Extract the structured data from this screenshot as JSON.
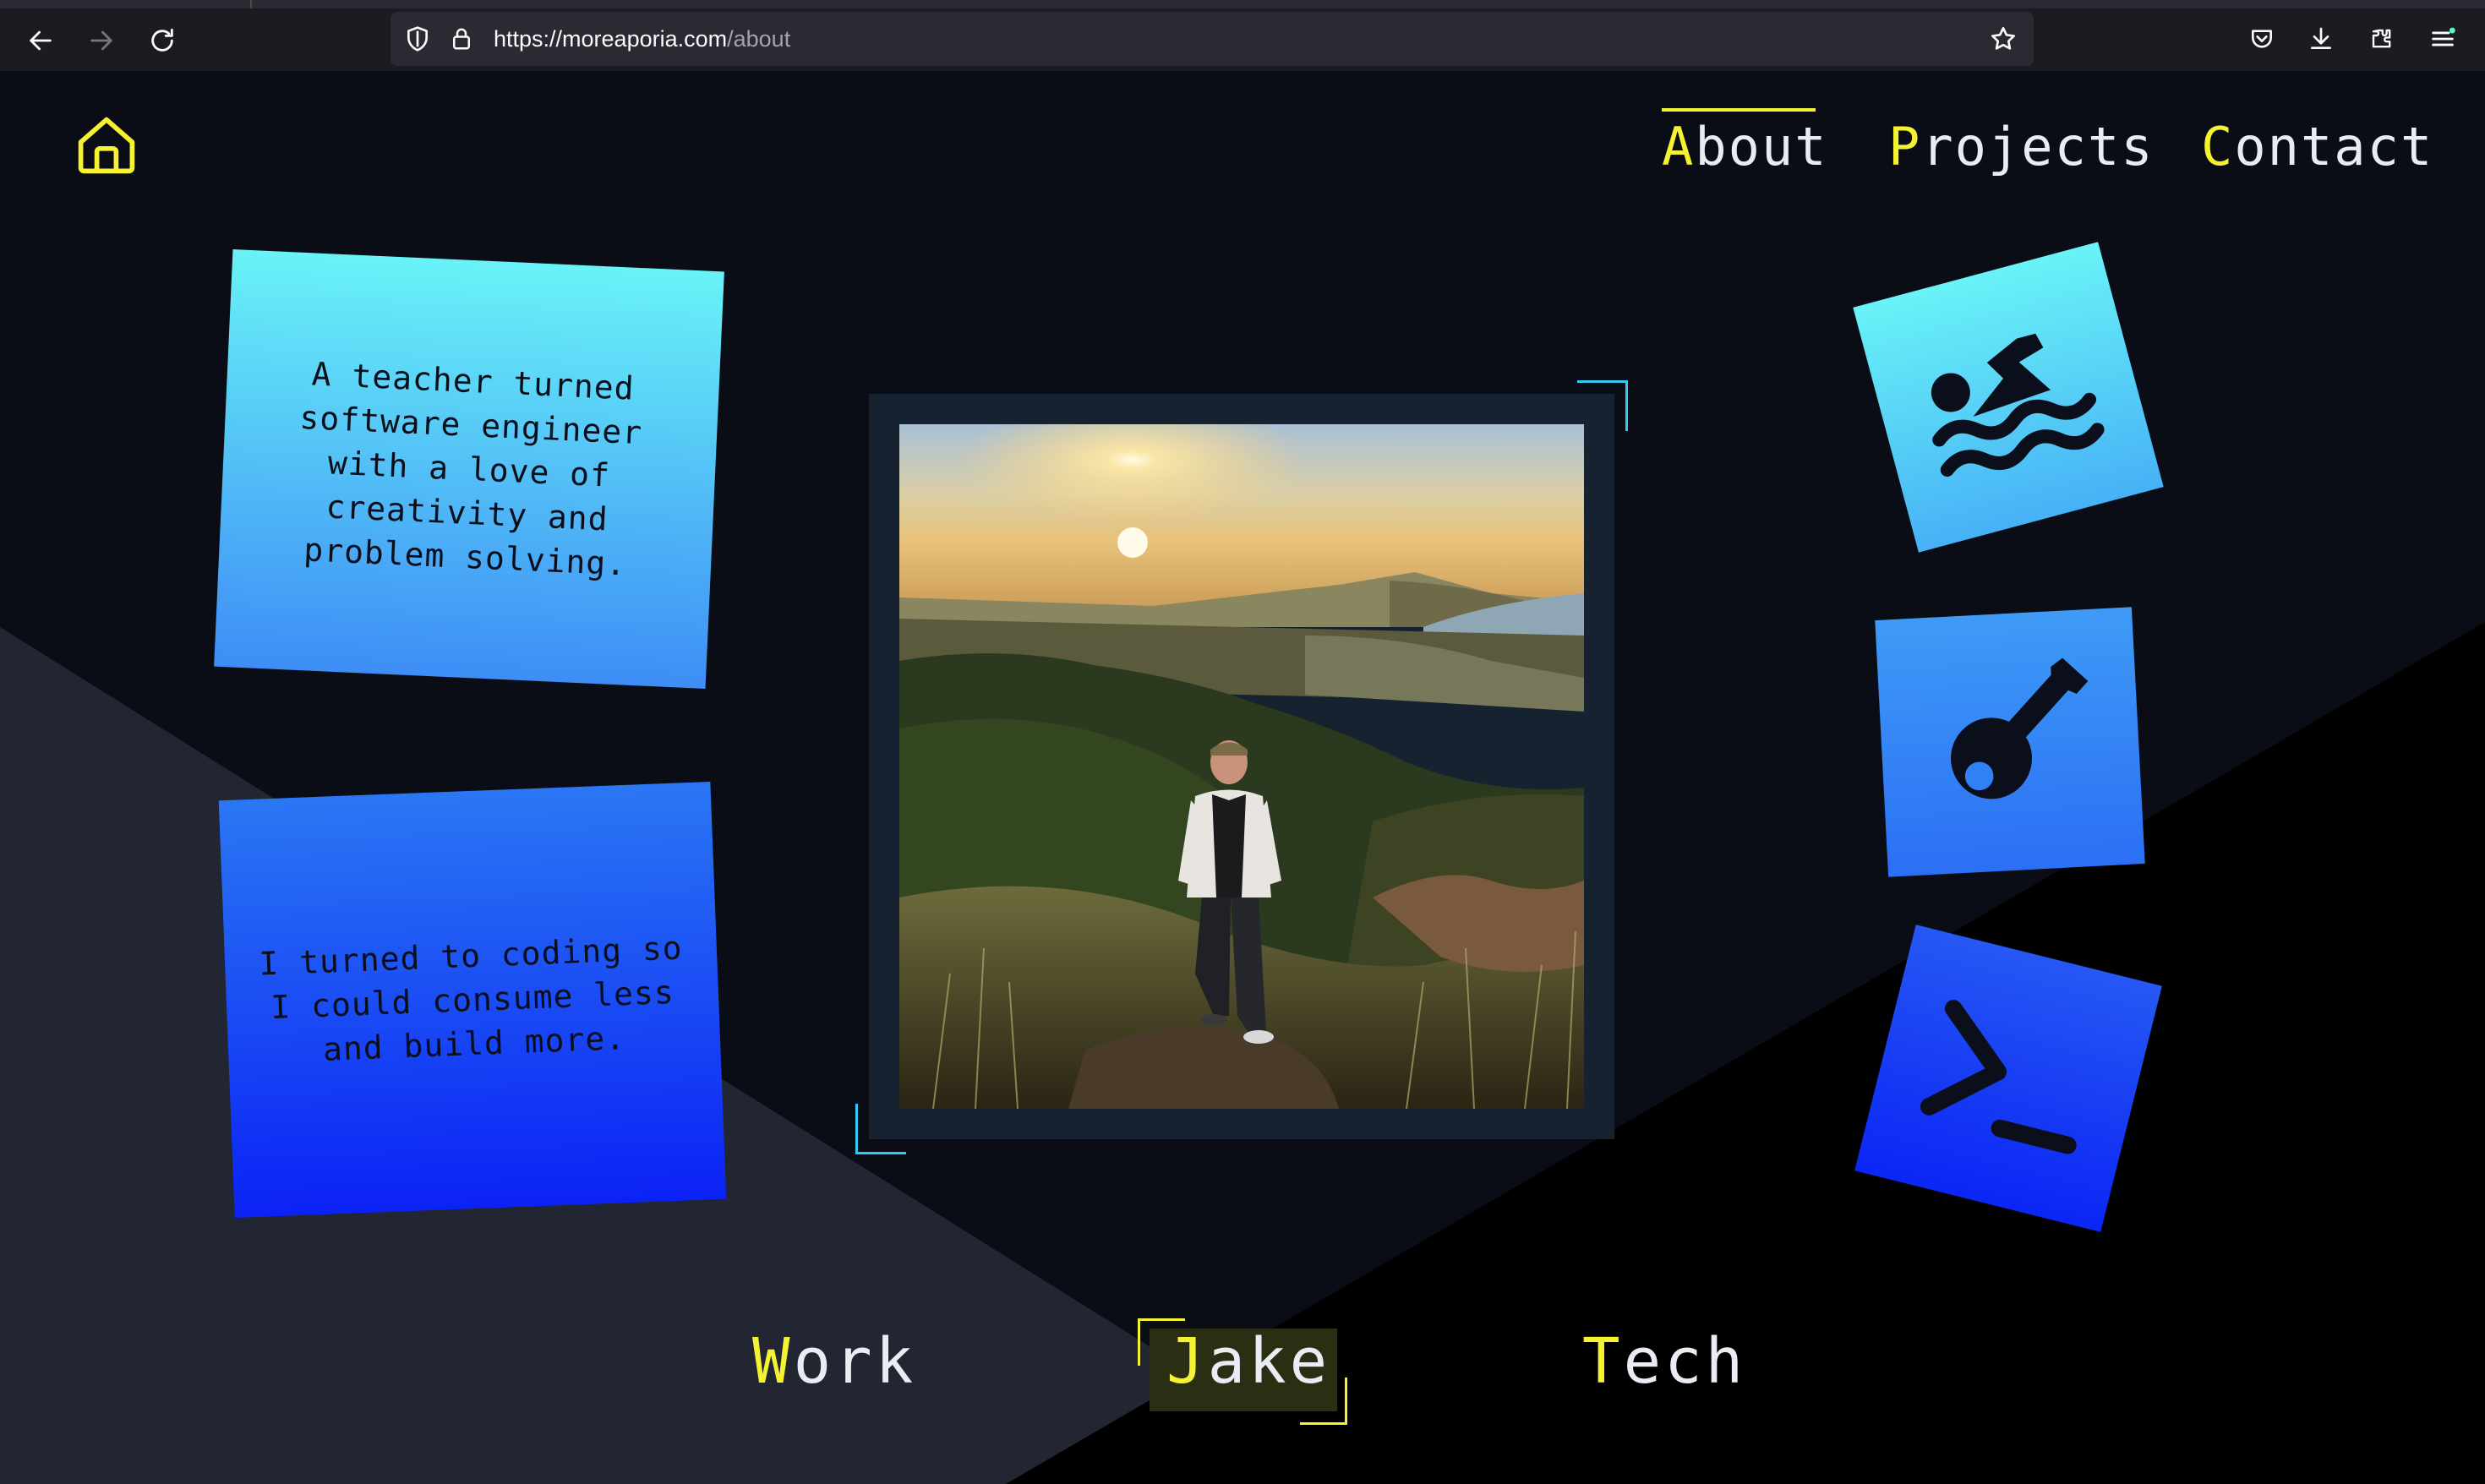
{
  "browser": {
    "url_host": "https://moreaporia.com",
    "url_path": "/about",
    "back_label": "Back",
    "forward_label": "Forward",
    "reload_label": "Reload"
  },
  "nav": {
    "items": [
      {
        "first": "A",
        "rest": "bout",
        "active": true
      },
      {
        "first": "P",
        "rest": "rojects",
        "active": false
      },
      {
        "first": "C",
        "rest": "ontact",
        "active": false
      }
    ]
  },
  "cards": [
    "A teacher turned software engineer with a love of creativity and problem solving.",
    "I turned to coding so I could consume less and build more."
  ],
  "hobby_icons": [
    "swimmer-icon",
    "guitar-icon",
    "terminal-icon"
  ],
  "bottom_nav": {
    "items": [
      {
        "first": "W",
        "rest": "ork"
      },
      {
        "first": "J",
        "rest": "ake",
        "selected": true
      },
      {
        "first": "T",
        "rest": "ech"
      }
    ]
  },
  "colors": {
    "accent_yellow": "#f5f232",
    "page_bg": "#0a0d16",
    "card_cyan": "#69f3f7",
    "card_blue": "#0b22f5"
  }
}
